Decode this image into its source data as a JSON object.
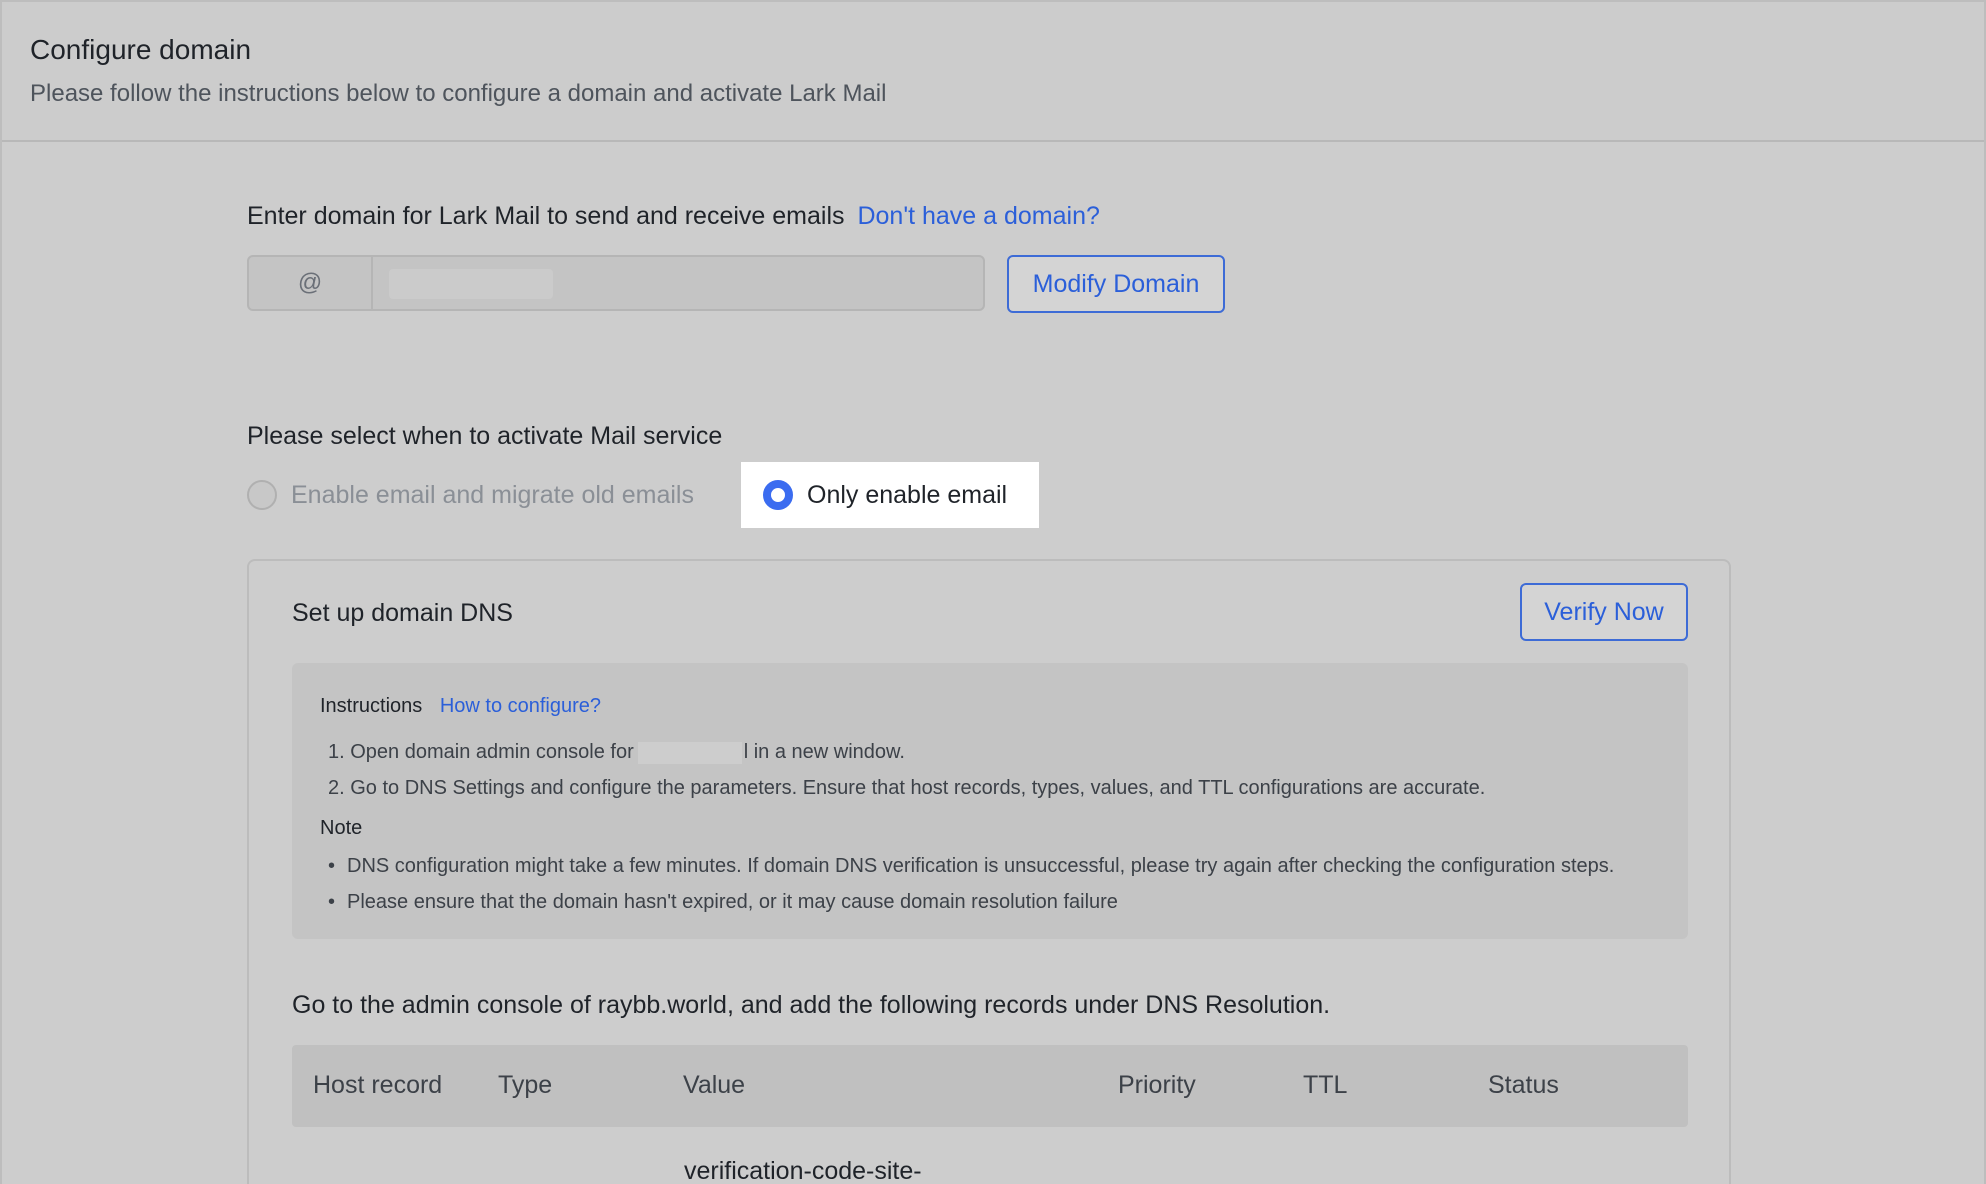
{
  "header": {
    "title": "Configure domain",
    "subtitle": "Please follow the instructions below to configure a domain and activate Lark Mail"
  },
  "domain_section": {
    "label": "Enter domain for Lark Mail to send and receive emails",
    "help_link": "Don't have a domain?",
    "input_prefix": "@",
    "modify_button": "Modify Domain"
  },
  "activation": {
    "label": "Please select when to activate Mail service",
    "options": [
      {
        "label": "Enable email and migrate old emails",
        "selected": false
      },
      {
        "label": "Only enable email",
        "selected": true
      }
    ]
  },
  "dns": {
    "title": "Set up domain DNS",
    "verify_button": "Verify Now",
    "instructions": {
      "heading": "Instructions",
      "help_link": "How to configure?",
      "step1_before": "1. Open domain admin console for",
      "step1_after": "l in a new window.",
      "step2": "2. Go to DNS Settings and configure the parameters. Ensure that host records, types, values, and TTL configurations are accurate.",
      "note_heading": "Note",
      "notes": [
        "DNS configuration might take a few minutes. If domain DNS verification is unsuccessful, please try again after checking the configuration steps.",
        "Please ensure that the domain hasn't expired, or it may cause domain resolution failure"
      ]
    },
    "records_intro": "Go to the admin console of raybb.world, and add the following records under DNS Resolution.",
    "table": {
      "columns": [
        "Host record",
        "Type",
        "Value",
        "Priority",
        "TTL",
        "Status"
      ],
      "first_row_value": "verification-code-site-"
    }
  },
  "colors": {
    "accent": "#2b5fd9",
    "radio_checked": "#3b6cf0"
  }
}
